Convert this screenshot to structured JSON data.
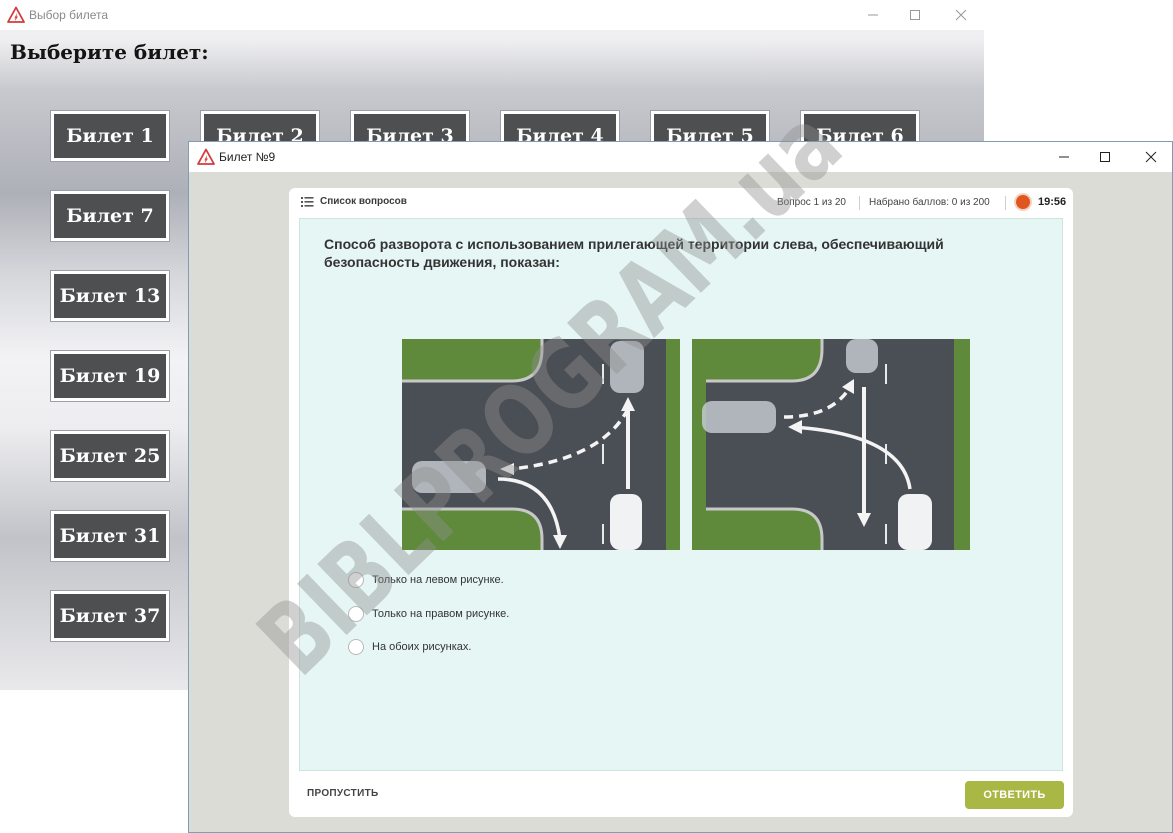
{
  "bg_window": {
    "title": "Выбор билета",
    "heading": "Выберите билет:",
    "tickets": [
      "Билет 1",
      "Билет 2",
      "Билет 3",
      "Билет 4",
      "Билет 5",
      "Билет 6",
      "Билет 7",
      "Билет 13",
      "Билет 19",
      "Билет 25",
      "Билет 31",
      "Билет 37"
    ]
  },
  "fg_window": {
    "title": "Билет №9",
    "questions_list_label": "Список вопросов",
    "question_counter": "Вопрос 1 из 20",
    "score": "Набрано баллов: 0 из 200",
    "timer": "19:56",
    "timer_color": "#e0561e",
    "question_text": "Способ разворота с использованием прилегающей территории слева, обеспечивающий безопасность движения, показан:",
    "options": [
      "Только на левом рисунке.",
      "Только на правом рисунке.",
      "На обоих рисунках."
    ],
    "skip_label": "ПРОПУСТИТЬ",
    "answer_label": "ОТВЕТИТЬ",
    "answer_color": "#a9b844"
  },
  "watermark": "BIBLPROGRAM.ua"
}
